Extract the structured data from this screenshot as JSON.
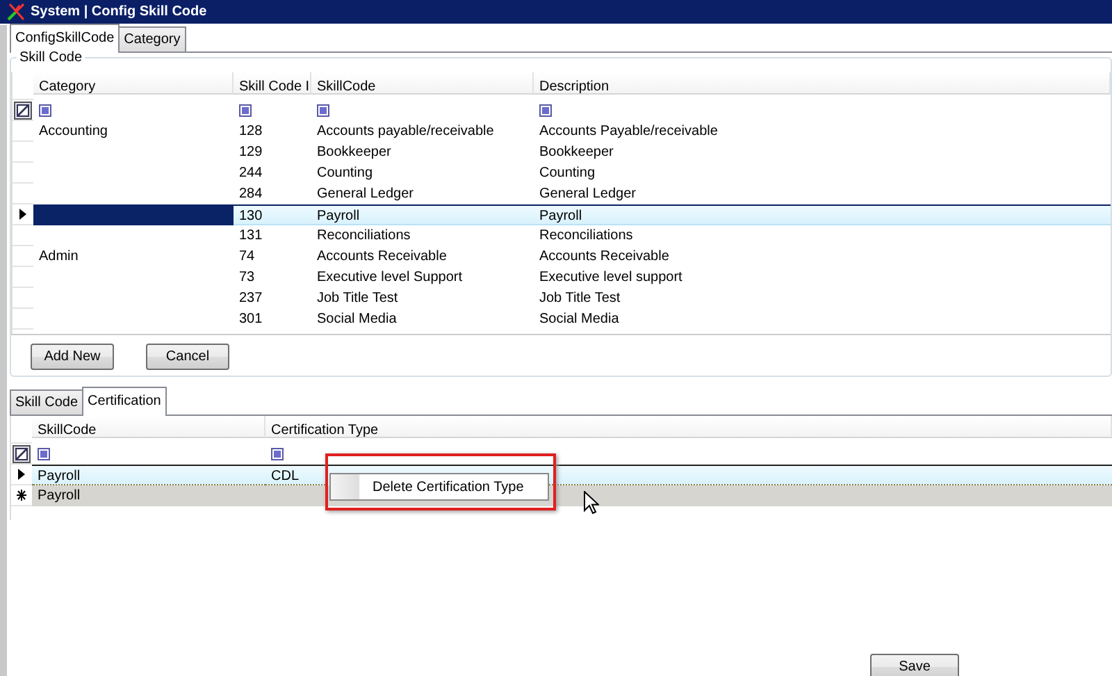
{
  "window": {
    "title": "System | Config Skill Code"
  },
  "tabs": [
    {
      "label": "ConfigSkillCode",
      "selected": true
    },
    {
      "label": "Category",
      "selected": false
    }
  ],
  "skill_group": {
    "title": "Skill Code",
    "columns": [
      "Category",
      "Skill Code I",
      "SkillCode",
      "Description"
    ],
    "rows": [
      {
        "category": "Accounting",
        "code": "128",
        "skill": "Accounts payable/receivable",
        "description": "Accounts Payable/receivable",
        "selected": false
      },
      {
        "category": "",
        "code": "129",
        "skill": "Bookkeeper",
        "description": "Bookkeeper",
        "selected": false
      },
      {
        "category": "",
        "code": "244",
        "skill": "Counting",
        "description": "Counting",
        "selected": false
      },
      {
        "category": "",
        "code": "284",
        "skill": "General Ledger",
        "description": "General Ledger",
        "selected": false
      },
      {
        "category": "",
        "code": "130",
        "skill": "Payroll",
        "description": "Payroll",
        "selected": true
      },
      {
        "category": "",
        "code": "131",
        "skill": "Reconciliations",
        "description": "Reconciliations",
        "selected": false
      },
      {
        "category": "Admin",
        "code": "74",
        "skill": "Accounts Receivable",
        "description": "Accounts Receivable",
        "selected": false
      },
      {
        "category": "",
        "code": "73",
        "skill": "Executive level Support",
        "description": "Executive level support",
        "selected": false
      },
      {
        "category": "",
        "code": "237",
        "skill": "Job Title Test",
        "description": "Job Title Test",
        "selected": false
      },
      {
        "category": "",
        "code": "301",
        "skill": "Social Media",
        "description": "Social Media",
        "selected": false
      }
    ],
    "buttons": [
      "Add New",
      "Cancel"
    ]
  },
  "detail_tabs": [
    {
      "label": "Skill Code",
      "selected": false
    },
    {
      "label": "Certification",
      "selected": true
    }
  ],
  "certification_grid": {
    "columns": [
      "SkillCode",
      "Certification Type"
    ],
    "rows": [
      {
        "kind": "current",
        "skill": "Payroll",
        "certification_type": "CDL"
      },
      {
        "kind": "new",
        "skill": "Payroll",
        "certification_type": ""
      }
    ]
  },
  "context_menu": {
    "items": [
      "Delete Certification Type"
    ]
  },
  "save_button": "Save"
}
